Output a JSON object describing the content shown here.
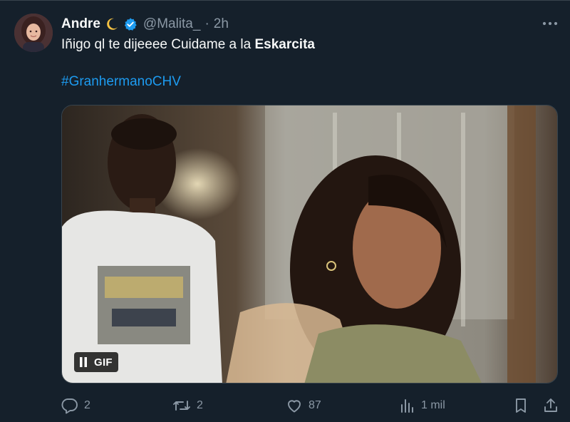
{
  "tweet": {
    "author_name": "Andre",
    "handle": "@Malita_",
    "separator": "·",
    "time": "2h",
    "text_plain": "Iñigo ql te dijeeee Cuidame a la ",
    "text_bold": "Eskarcita",
    "hashtag": "#GranhermanoCHV",
    "media": {
      "type": "gif",
      "badge_label": "GIF",
      "description_icon": "pause-icon"
    },
    "actions": {
      "reply_count": "2",
      "retweet_count": "2",
      "like_count": "87",
      "views_count": "1 mil"
    }
  },
  "colors": {
    "background": "#15202b",
    "text": "#f7f9f9",
    "muted": "#8b98a5",
    "accent": "#1d9bf0",
    "border": "#38444d"
  },
  "icons": [
    "crescent-moon-icon",
    "verified-badge-icon",
    "more-icon",
    "reply-icon",
    "retweet-icon",
    "like-icon",
    "views-icon",
    "bookmark-icon",
    "share-icon",
    "pause-icon"
  ]
}
